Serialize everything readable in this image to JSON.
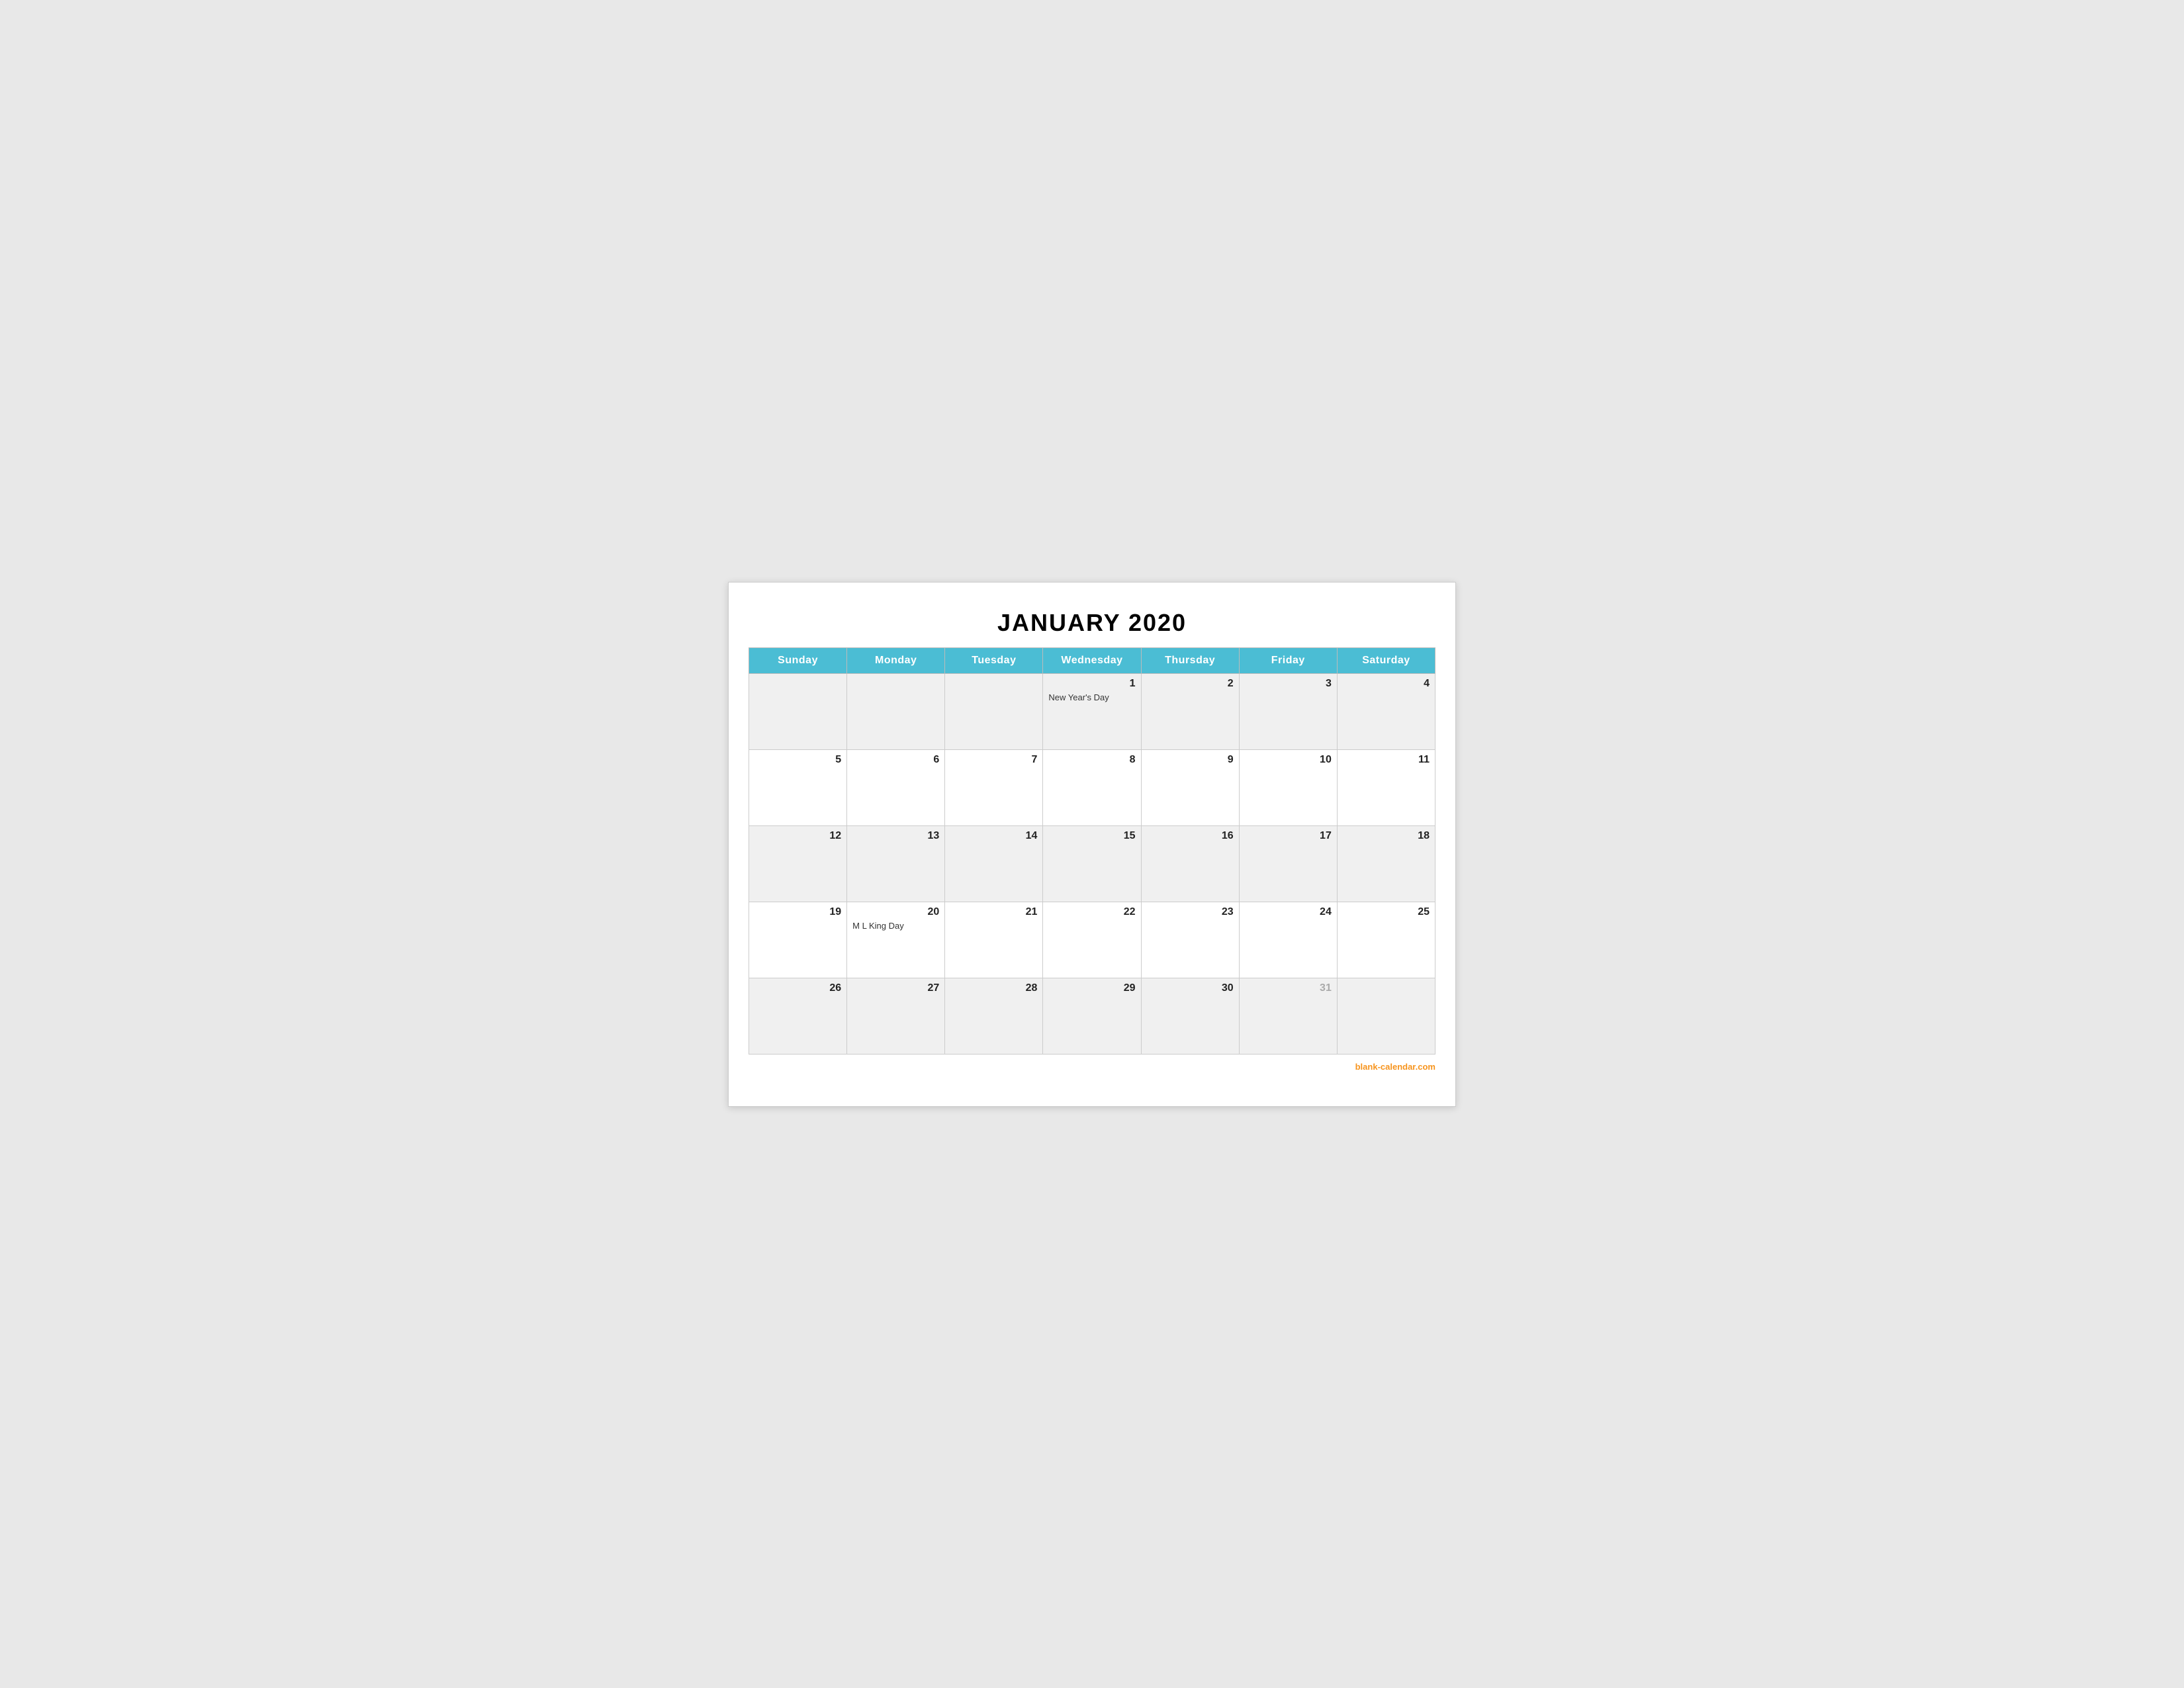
{
  "title": "JANUARY 2020",
  "days_of_week": [
    "Sunday",
    "Monday",
    "Tuesday",
    "Wednesday",
    "Thursday",
    "Friday",
    "Saturday"
  ],
  "weeks": [
    [
      {
        "day": "",
        "event": ""
      },
      {
        "day": "",
        "event": ""
      },
      {
        "day": "",
        "event": ""
      },
      {
        "day": "1",
        "event": "New Year's Day"
      },
      {
        "day": "2",
        "event": ""
      },
      {
        "day": "3",
        "event": ""
      },
      {
        "day": "4",
        "event": ""
      }
    ],
    [
      {
        "day": "5",
        "event": ""
      },
      {
        "day": "6",
        "event": ""
      },
      {
        "day": "7",
        "event": ""
      },
      {
        "day": "8",
        "event": ""
      },
      {
        "day": "9",
        "event": ""
      },
      {
        "day": "10",
        "event": ""
      },
      {
        "day": "11",
        "event": ""
      }
    ],
    [
      {
        "day": "12",
        "event": ""
      },
      {
        "day": "13",
        "event": ""
      },
      {
        "day": "14",
        "event": ""
      },
      {
        "day": "15",
        "event": ""
      },
      {
        "day": "16",
        "event": ""
      },
      {
        "day": "17",
        "event": ""
      },
      {
        "day": "18",
        "event": ""
      }
    ],
    [
      {
        "day": "19",
        "event": ""
      },
      {
        "day": "20",
        "event": "M L King Day"
      },
      {
        "day": "21",
        "event": ""
      },
      {
        "day": "22",
        "event": ""
      },
      {
        "day": "23",
        "event": ""
      },
      {
        "day": "24",
        "event": ""
      },
      {
        "day": "25",
        "event": ""
      }
    ],
    [
      {
        "day": "26",
        "event": ""
      },
      {
        "day": "27",
        "event": ""
      },
      {
        "day": "28",
        "event": ""
      },
      {
        "day": "29",
        "event": ""
      },
      {
        "day": "30",
        "event": ""
      },
      {
        "day": "31",
        "event": "",
        "faded": true
      },
      {
        "day": "",
        "event": ""
      }
    ]
  ],
  "footer": {
    "label": "blank-calendar.com",
    "url": "blank-calendar.com"
  },
  "colors": {
    "header_bg": "#4bbdd4",
    "header_text": "#ffffff",
    "footer_link": "#f7941d"
  }
}
